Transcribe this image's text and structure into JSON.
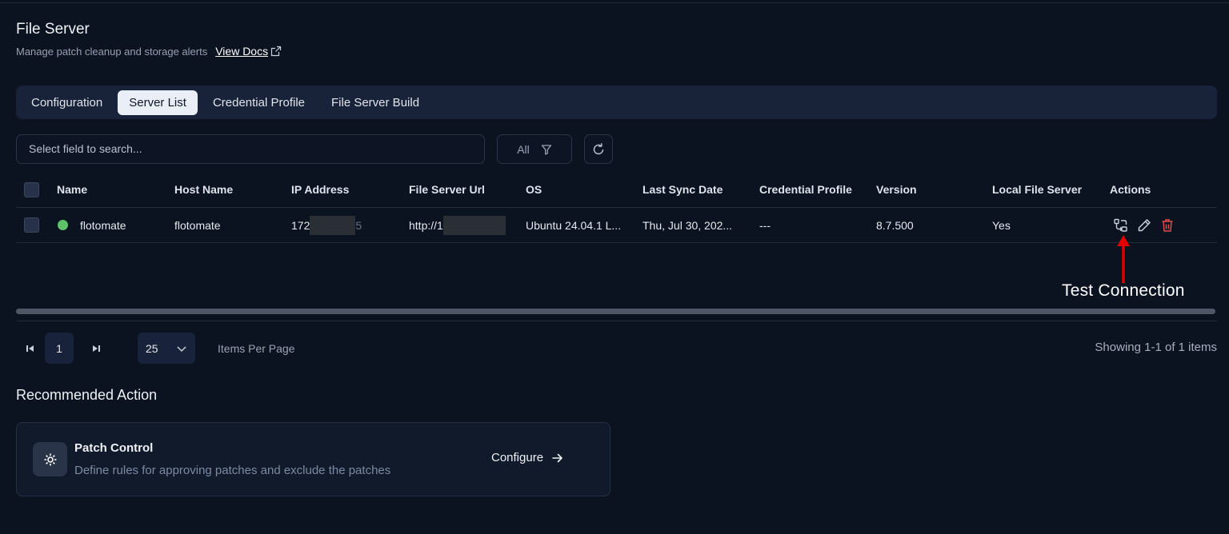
{
  "header": {
    "title": "File Server",
    "subtitle": "Manage patch cleanup and storage alerts",
    "docs_link": "View Docs"
  },
  "tabs": [
    {
      "label": "Configuration",
      "active": false
    },
    {
      "label": "Server List",
      "active": true
    },
    {
      "label": "Credential Profile",
      "active": false
    },
    {
      "label": "File Server Build",
      "active": false
    }
  ],
  "search": {
    "placeholder": "Select field to search..."
  },
  "filter": {
    "value": "All"
  },
  "table": {
    "columns": [
      "Name",
      "Host Name",
      "IP Address",
      "File Server Url",
      "OS",
      "Last Sync Date",
      "Credential Profile",
      "Version",
      "Local File Server",
      "Actions"
    ],
    "rows": [
      {
        "status": "online",
        "name": "flotomate",
        "host_name": "flotomate",
        "ip_prefix": "172",
        "ip_suffix": "5",
        "url_prefix": "http://1",
        "os": "Ubuntu 24.04.1 L...",
        "last_sync": "Thu, Jul 30, 202...",
        "credential_profile": "---",
        "version": "8.7.500",
        "local_file_server": "Yes"
      }
    ]
  },
  "pagination": {
    "current_page": "1",
    "per_page": "25",
    "per_page_label": "Items Per Page",
    "showing": "Showing 1-1 of 1 items"
  },
  "recommended": {
    "title": "Recommended Action",
    "card": {
      "name": "Patch Control",
      "description": "Define rules for approving patches and exclude the patches",
      "action": "Configure"
    }
  },
  "annotation": {
    "label": "Test Connection"
  },
  "colors": {
    "background": "#0b1220",
    "status_online": "#5ec26a",
    "delete": "#e24a4a",
    "annotation_arrow": "#e00000"
  }
}
